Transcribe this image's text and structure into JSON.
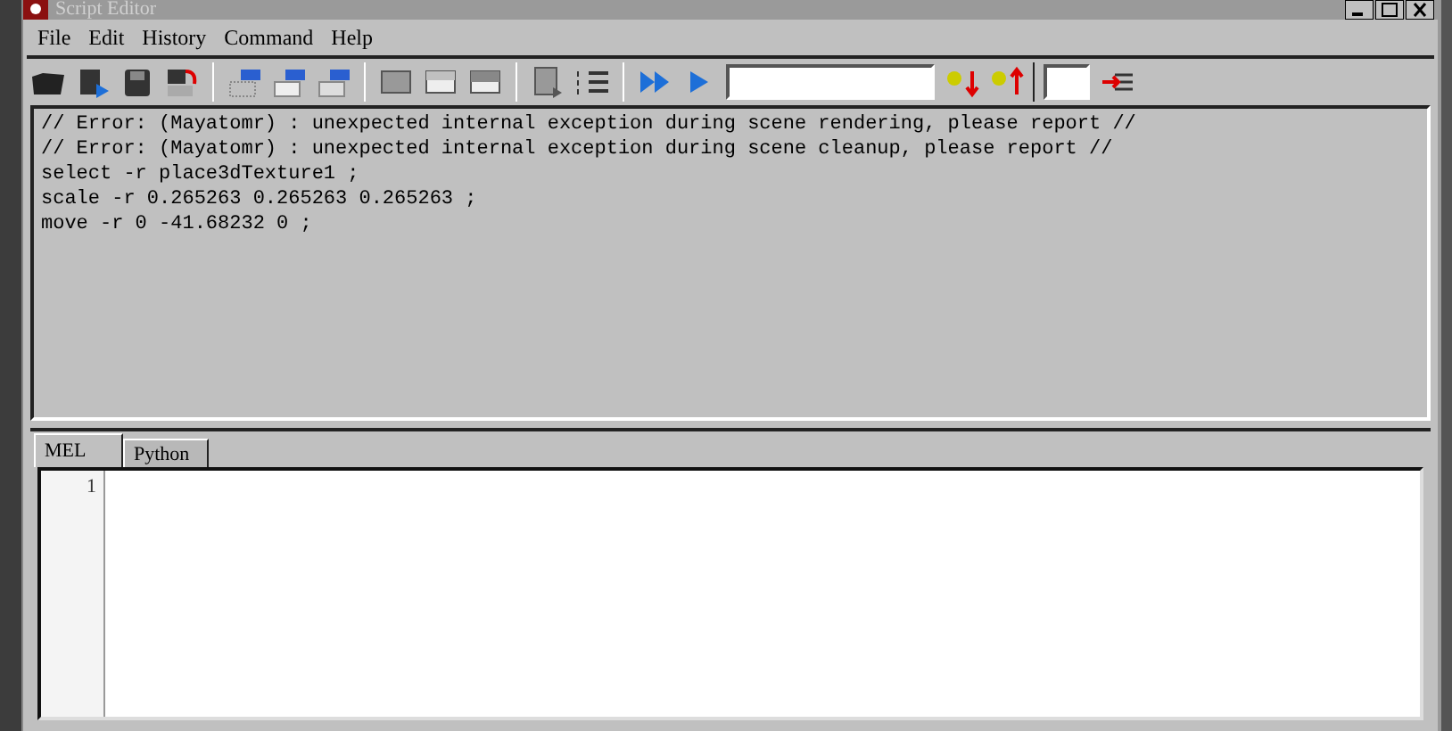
{
  "window": {
    "title": "Script Editor"
  },
  "menu": [
    "File",
    "Edit",
    "History",
    "Command",
    "Help"
  ],
  "output": {
    "lines": [
      "// Error: (Mayatomr) : unexpected internal exception during scene rendering, please report //",
      "// Error: (Mayatomr) : unexpected internal exception during scene cleanup, please report //",
      "select -r place3dTexture1 ;",
      "scale -r 0.265263 0.265263 0.265263 ;",
      "move -r 0 -41.68232 0 ;"
    ]
  },
  "tabs": [
    {
      "label": "MEL",
      "selected": true
    },
    {
      "label": "Python",
      "selected": false
    }
  ],
  "editor": {
    "line_numbers": [
      "1"
    ]
  }
}
